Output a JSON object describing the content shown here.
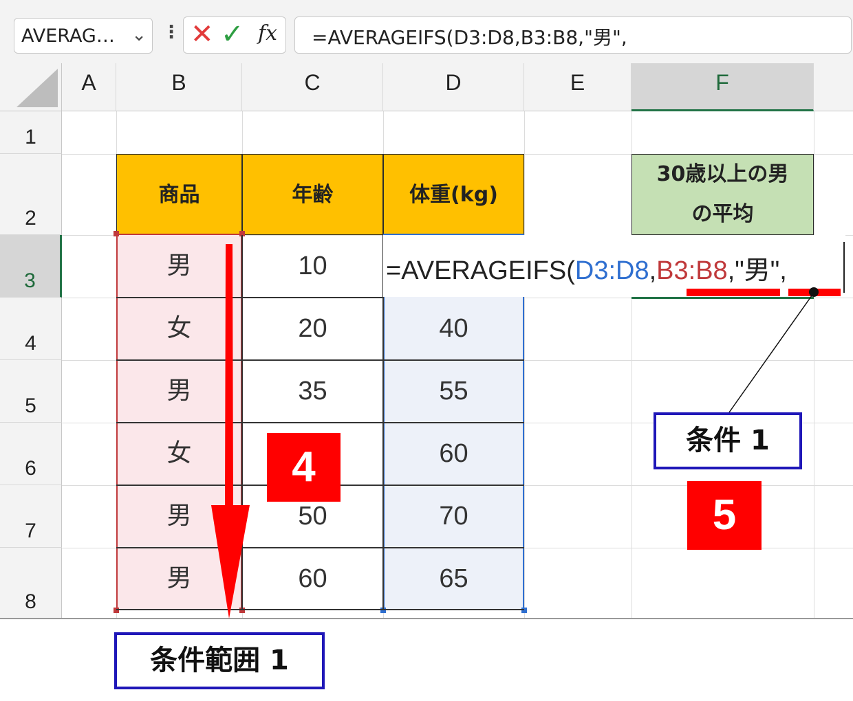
{
  "formula_bar": {
    "name_box": "AVERAG…",
    "name_box_arrow": "⌄",
    "dots": "⋮",
    "cancel_icon": "✕",
    "enter_icon": "✓",
    "fx_label": "fx",
    "formula": "=AVERAGEIFS(D3:D8,B3:B8,\"男\","
  },
  "columns": [
    "A",
    "B",
    "C",
    "D",
    "E",
    "F"
  ],
  "rows": [
    "1",
    "2",
    "3",
    "4",
    "5",
    "6",
    "7",
    "8"
  ],
  "table": {
    "headers": [
      "商品",
      "年齢",
      "体重(kg)"
    ],
    "col_b": [
      "男",
      "女",
      "男",
      "女",
      "男",
      "男"
    ],
    "col_c": [
      "10",
      "20",
      "35",
      "",
      "50",
      "60"
    ],
    "col_d": [
      "",
      "40",
      "55",
      "60",
      "70",
      "65"
    ]
  },
  "result_header": {
    "line1": "30歳以上の男",
    "line2": "の平均"
  },
  "cell_edit": {
    "prefix": "=AVERAGEIFS(",
    "ref1": "D3:D8",
    "sep1": ",",
    "ref2": "B3:B8",
    "rest": ",\"男\","
  },
  "callouts": {
    "condition1": "条件 1",
    "condition_range1": "条件範囲 1",
    "step4": "4",
    "step5": "5"
  },
  "colors": {
    "header_orange": "#ffc000",
    "header_green": "#c5e0b4",
    "range_red": "#c0393b",
    "range_blue": "#2f6fd0",
    "accent_red": "#ff0000",
    "callout_border": "#1f17b8",
    "excel_green": "#217346"
  }
}
